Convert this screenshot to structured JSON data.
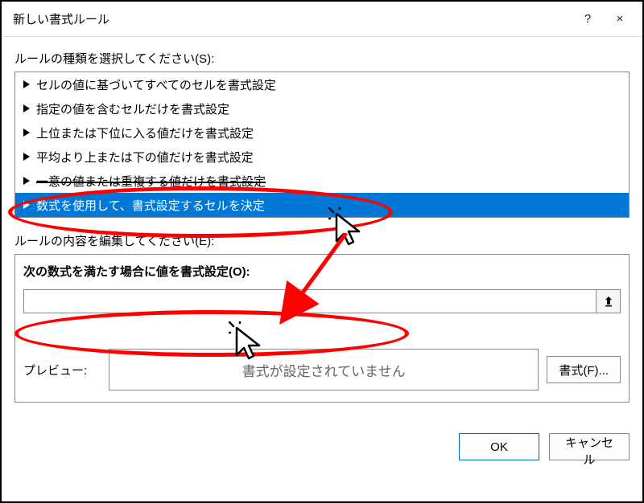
{
  "titlebar": {
    "title": "新しい書式ルール",
    "help": "?",
    "close": "×"
  },
  "section": {
    "select_type_label": "ルールの種類を選択してください(S):",
    "edit_content_label": "ルールの内容を編集してください(E):"
  },
  "rule_types": [
    "セルの値に基づいてすべてのセルを書式設定",
    "指定の値を含むセルだけを書式設定",
    "上位または下位に入る値だけを書式設定",
    "平均より上または下の値だけを書式設定",
    "一意の値または重複する値だけを書式設定",
    "数式を使用して、書式設定するセルを決定"
  ],
  "rule_types_selected_index": 5,
  "formula": {
    "label": "次の数式を満たす場合に値を書式設定(O):",
    "value": ""
  },
  "preview": {
    "label": "プレビュー:",
    "placeholder_text": "書式が設定されていません",
    "format_button": "書式(F)..."
  },
  "footer": {
    "ok": "OK",
    "cancel": "キャンセル"
  },
  "annotation": {
    "cursor_icon": "cursor",
    "spark_icon": "click-spark",
    "arrow_icon": "arrow"
  }
}
